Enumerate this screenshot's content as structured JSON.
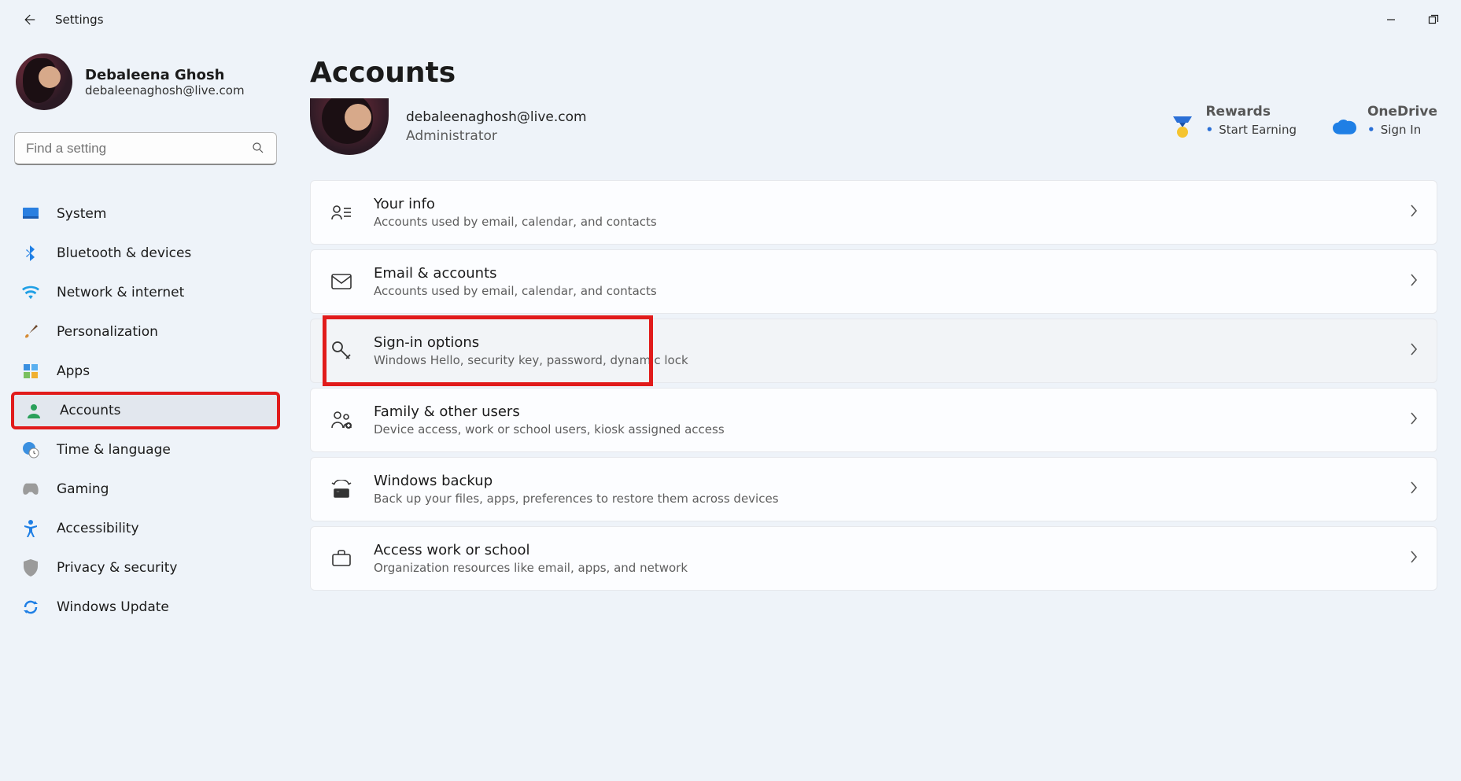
{
  "window": {
    "title": "Settings"
  },
  "profile": {
    "name": "Debaleena Ghosh",
    "email": "debaleenaghosh@live.com"
  },
  "search": {
    "placeholder": "Find a setting"
  },
  "nav": {
    "items": [
      {
        "label": "System"
      },
      {
        "label": "Bluetooth & devices"
      },
      {
        "label": "Network & internet"
      },
      {
        "label": "Personalization"
      },
      {
        "label": "Apps"
      },
      {
        "label": "Accounts"
      },
      {
        "label": "Time & language"
      },
      {
        "label": "Gaming"
      },
      {
        "label": "Accessibility"
      },
      {
        "label": "Privacy & security"
      },
      {
        "label": "Windows Update"
      }
    ]
  },
  "page": {
    "title": "Accounts",
    "account": {
      "email": "debaleenaghosh@live.com",
      "role": "Administrator"
    },
    "rewards": {
      "label": "Rewards",
      "sub": "Start Earning"
    },
    "onedrive": {
      "label": "OneDrive",
      "sub": "Sign In"
    },
    "cards": [
      {
        "title": "Your info",
        "sub": "Accounts used by email, calendar, and contacts"
      },
      {
        "title": "Email & accounts",
        "sub": "Accounts used by email, calendar, and contacts"
      },
      {
        "title": "Sign-in options",
        "sub": "Windows Hello, security key, password, dynamic lock"
      },
      {
        "title": "Family & other users",
        "sub": "Device access, work or school users, kiosk assigned access"
      },
      {
        "title": "Windows backup",
        "sub": "Back up your files, apps, preferences to restore them across devices"
      },
      {
        "title": "Access work or school",
        "sub": "Organization resources like email, apps, and network"
      }
    ]
  }
}
